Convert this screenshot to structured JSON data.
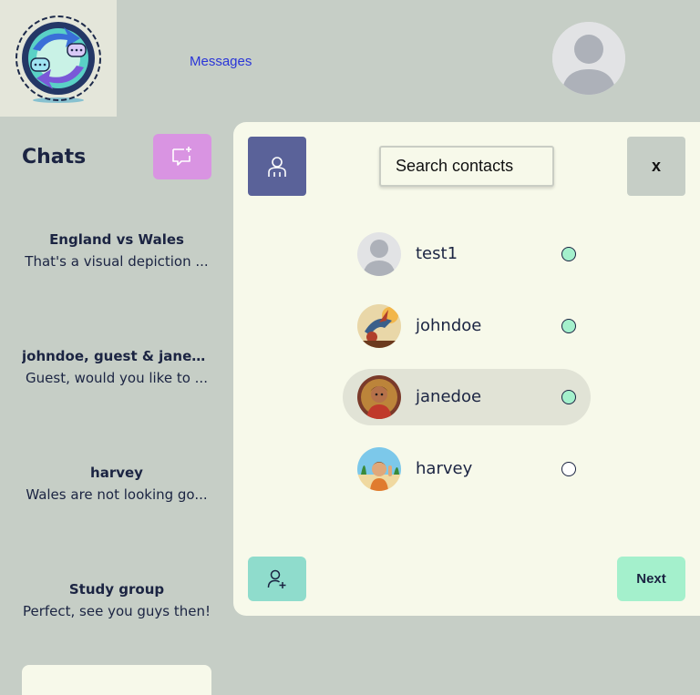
{
  "header": {
    "nav_link": "Messages",
    "logo_icon": "chat-swap-logo-icon",
    "profile_icon": "user-avatar-icon"
  },
  "sidebar": {
    "title": "Chats",
    "new_chat_icon": "new-message-icon",
    "chats": [
      {
        "name": "England vs Wales",
        "preview": "That's a visual depiction ..."
      },
      {
        "name": "johndoe, guest & janed...",
        "preview": "Guest, would you like to ..."
      },
      {
        "name": "harvey",
        "preview": "Wales are not looking go..."
      },
      {
        "name": "Study group",
        "preview": "Perfect, see you guys then!"
      }
    ]
  },
  "modal": {
    "contacts_icon": "contacts-icon",
    "search": {
      "placeholder": "Search contacts",
      "value": ""
    },
    "close_label": "x",
    "contacts": [
      {
        "name": "test1",
        "online": true,
        "selected": false
      },
      {
        "name": "johndoe",
        "online": true,
        "selected": false
      },
      {
        "name": "janedoe",
        "online": true,
        "selected": true
      },
      {
        "name": "harvey",
        "online": false,
        "selected": false
      }
    ],
    "add_contact_icon": "add-user-icon",
    "next_label": "Next"
  },
  "colors": {
    "background": "#c6cec6",
    "panel": "#f7f9ea",
    "new_chat_button": "#d994e2",
    "contacts_button": "#5a6299",
    "add_contact_button": "#8fdccc",
    "next_button": "#a4f0cc",
    "online_dot": "#a4f0cc",
    "link": "#2a35d8"
  }
}
